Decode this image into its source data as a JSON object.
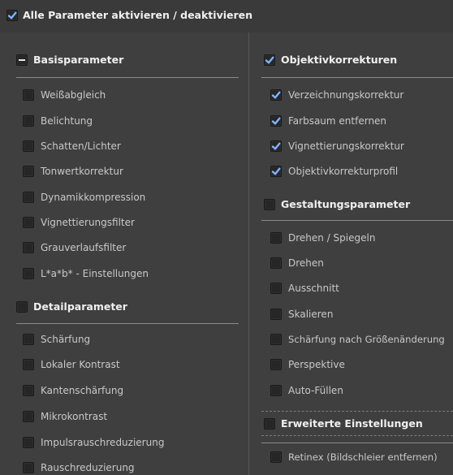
{
  "master_toggle": {
    "label": "Alle Parameter aktivieren / deaktivieren",
    "checked": true
  },
  "left": {
    "basis": {
      "header": "Basisparameter",
      "state": "indeterminate",
      "items": [
        "Weißabgleich",
        "Belichtung",
        "Schatten/Lichter",
        "Tonwertkorrektur",
        "Dynamikkompression",
        "Vignettierungsfilter",
        "Grauverlaufsfilter",
        "L*a*b* - Einstellungen"
      ]
    },
    "detail": {
      "header": "Detailparameter",
      "state": "unchecked",
      "items": [
        "Schärfung",
        "Lokaler Kontrast",
        "Kantenschärfung",
        "Mikrokontrast",
        "Impulsrauschreduzierung",
        "Rauschreduzierung"
      ]
    }
  },
  "right": {
    "objektiv": {
      "header": "Objektivkorrekturen",
      "state": "checked",
      "items": [
        "Verzeichnungskorrektur",
        "Farbsaum entfernen",
        "Vignettierungskorrektur",
        "Objektivkorrekturprofil"
      ]
    },
    "gestaltung": {
      "header": "Gestaltungsparameter",
      "state": "unchecked",
      "items": [
        "Drehen / Spiegeln",
        "Drehen",
        "Ausschnitt",
        "Skalieren",
        "Schärfung nach Größenänderung",
        "Perspektive",
        "Auto-Füllen"
      ]
    },
    "erweitert": {
      "header": "Erweiterte Einstellungen",
      "state": "unchecked",
      "items": [
        "Retinex (Bildschleier entfernen)"
      ]
    }
  },
  "colors": {
    "background": "#3f3f3f",
    "check_accent": "#7fb4ff"
  }
}
